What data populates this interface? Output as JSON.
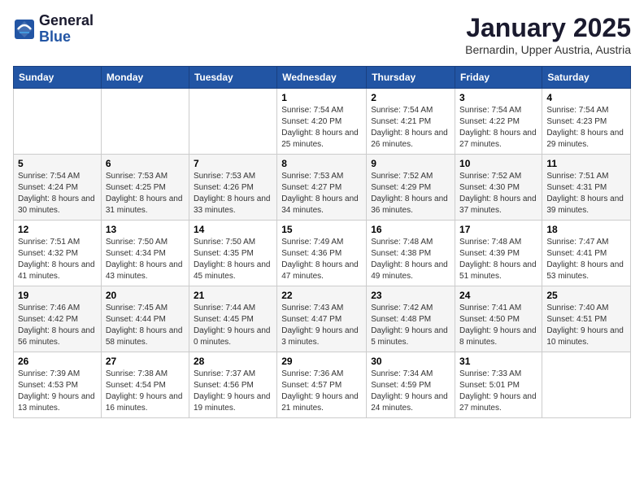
{
  "logo": {
    "general": "General",
    "blue": "Blue"
  },
  "title": "January 2025",
  "subtitle": "Bernardin, Upper Austria, Austria",
  "days_of_week": [
    "Sunday",
    "Monday",
    "Tuesday",
    "Wednesday",
    "Thursday",
    "Friday",
    "Saturday"
  ],
  "weeks": [
    [
      {
        "day": "",
        "info": ""
      },
      {
        "day": "",
        "info": ""
      },
      {
        "day": "",
        "info": ""
      },
      {
        "day": "1",
        "info": "Sunrise: 7:54 AM\nSunset: 4:20 PM\nDaylight: 8 hours and 25 minutes."
      },
      {
        "day": "2",
        "info": "Sunrise: 7:54 AM\nSunset: 4:21 PM\nDaylight: 8 hours and 26 minutes."
      },
      {
        "day": "3",
        "info": "Sunrise: 7:54 AM\nSunset: 4:22 PM\nDaylight: 8 hours and 27 minutes."
      },
      {
        "day": "4",
        "info": "Sunrise: 7:54 AM\nSunset: 4:23 PM\nDaylight: 8 hours and 29 minutes."
      }
    ],
    [
      {
        "day": "5",
        "info": "Sunrise: 7:54 AM\nSunset: 4:24 PM\nDaylight: 8 hours and 30 minutes."
      },
      {
        "day": "6",
        "info": "Sunrise: 7:53 AM\nSunset: 4:25 PM\nDaylight: 8 hours and 31 minutes."
      },
      {
        "day": "7",
        "info": "Sunrise: 7:53 AM\nSunset: 4:26 PM\nDaylight: 8 hours and 33 minutes."
      },
      {
        "day": "8",
        "info": "Sunrise: 7:53 AM\nSunset: 4:27 PM\nDaylight: 8 hours and 34 minutes."
      },
      {
        "day": "9",
        "info": "Sunrise: 7:52 AM\nSunset: 4:29 PM\nDaylight: 8 hours and 36 minutes."
      },
      {
        "day": "10",
        "info": "Sunrise: 7:52 AM\nSunset: 4:30 PM\nDaylight: 8 hours and 37 minutes."
      },
      {
        "day": "11",
        "info": "Sunrise: 7:51 AM\nSunset: 4:31 PM\nDaylight: 8 hours and 39 minutes."
      }
    ],
    [
      {
        "day": "12",
        "info": "Sunrise: 7:51 AM\nSunset: 4:32 PM\nDaylight: 8 hours and 41 minutes."
      },
      {
        "day": "13",
        "info": "Sunrise: 7:50 AM\nSunset: 4:34 PM\nDaylight: 8 hours and 43 minutes."
      },
      {
        "day": "14",
        "info": "Sunrise: 7:50 AM\nSunset: 4:35 PM\nDaylight: 8 hours and 45 minutes."
      },
      {
        "day": "15",
        "info": "Sunrise: 7:49 AM\nSunset: 4:36 PM\nDaylight: 8 hours and 47 minutes."
      },
      {
        "day": "16",
        "info": "Sunrise: 7:48 AM\nSunset: 4:38 PM\nDaylight: 8 hours and 49 minutes."
      },
      {
        "day": "17",
        "info": "Sunrise: 7:48 AM\nSunset: 4:39 PM\nDaylight: 8 hours and 51 minutes."
      },
      {
        "day": "18",
        "info": "Sunrise: 7:47 AM\nSunset: 4:41 PM\nDaylight: 8 hours and 53 minutes."
      }
    ],
    [
      {
        "day": "19",
        "info": "Sunrise: 7:46 AM\nSunset: 4:42 PM\nDaylight: 8 hours and 56 minutes."
      },
      {
        "day": "20",
        "info": "Sunrise: 7:45 AM\nSunset: 4:44 PM\nDaylight: 8 hours and 58 minutes."
      },
      {
        "day": "21",
        "info": "Sunrise: 7:44 AM\nSunset: 4:45 PM\nDaylight: 9 hours and 0 minutes."
      },
      {
        "day": "22",
        "info": "Sunrise: 7:43 AM\nSunset: 4:47 PM\nDaylight: 9 hours and 3 minutes."
      },
      {
        "day": "23",
        "info": "Sunrise: 7:42 AM\nSunset: 4:48 PM\nDaylight: 9 hours and 5 minutes."
      },
      {
        "day": "24",
        "info": "Sunrise: 7:41 AM\nSunset: 4:50 PM\nDaylight: 9 hours and 8 minutes."
      },
      {
        "day": "25",
        "info": "Sunrise: 7:40 AM\nSunset: 4:51 PM\nDaylight: 9 hours and 10 minutes."
      }
    ],
    [
      {
        "day": "26",
        "info": "Sunrise: 7:39 AM\nSunset: 4:53 PM\nDaylight: 9 hours and 13 minutes."
      },
      {
        "day": "27",
        "info": "Sunrise: 7:38 AM\nSunset: 4:54 PM\nDaylight: 9 hours and 16 minutes."
      },
      {
        "day": "28",
        "info": "Sunrise: 7:37 AM\nSunset: 4:56 PM\nDaylight: 9 hours and 19 minutes."
      },
      {
        "day": "29",
        "info": "Sunrise: 7:36 AM\nSunset: 4:57 PM\nDaylight: 9 hours and 21 minutes."
      },
      {
        "day": "30",
        "info": "Sunrise: 7:34 AM\nSunset: 4:59 PM\nDaylight: 9 hours and 24 minutes."
      },
      {
        "day": "31",
        "info": "Sunrise: 7:33 AM\nSunset: 5:01 PM\nDaylight: 9 hours and 27 minutes."
      },
      {
        "day": "",
        "info": ""
      }
    ]
  ]
}
